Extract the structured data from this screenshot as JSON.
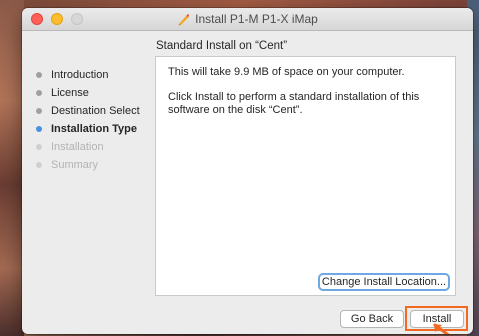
{
  "window": {
    "title": "Install P1-M P1-X iMap",
    "title_icon": "installer-icon"
  },
  "heading": "Standard Install on “Cent”",
  "sidebar": {
    "steps": [
      {
        "label": "Introduction",
        "state": "done"
      },
      {
        "label": "License",
        "state": "done"
      },
      {
        "label": "Destination Select",
        "state": "done"
      },
      {
        "label": "Installation Type",
        "state": "active"
      },
      {
        "label": "Installation",
        "state": "pending"
      },
      {
        "label": "Summary",
        "state": "pending"
      }
    ]
  },
  "panel": {
    "line1": "This will take 9.9 MB of space on your computer.",
    "line2": "Click Install to perform a standard installation of this software on the disk “Cent”."
  },
  "buttons": {
    "change_location": "Change Install Location...",
    "go_back": "Go Back",
    "install": "Install"
  },
  "colors": {
    "accent": "#4a90e2",
    "highlight": "#f26a21",
    "close": "#ff5f57",
    "minimize": "#ffbd2e"
  }
}
